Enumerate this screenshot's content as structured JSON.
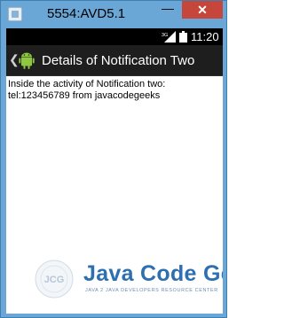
{
  "window": {
    "title": "5554:AVD5.1",
    "minimize_label": "—",
    "close_label": "✕"
  },
  "statusbar": {
    "signal_label": "3G",
    "time": "11:20"
  },
  "actionbar": {
    "title": "Details of Notification Two"
  },
  "content": {
    "line1": "Inside the activity of Notification two:",
    "line2": "tel:123456789 from javacodegeeks"
  },
  "logo": {
    "initials": "JCG",
    "title": "Java Code Geeks",
    "tagline": "JAVA 2 JAVA DEVELOPERS RESOURCE CENTER"
  }
}
